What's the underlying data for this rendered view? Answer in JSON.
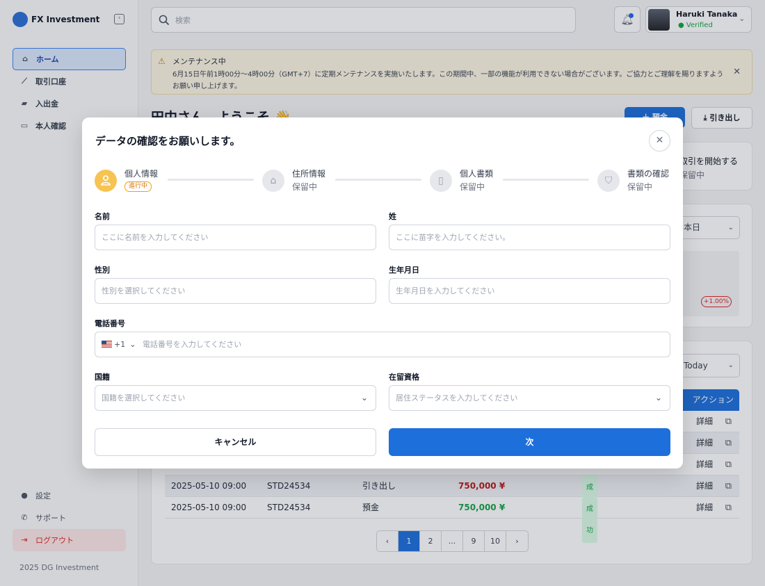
{
  "brand": {
    "name": "FX Investment"
  },
  "sidebar": {
    "items": [
      {
        "label": "ホーム",
        "icon": "home-icon"
      },
      {
        "label": "取引口座",
        "icon": "chart-line-icon"
      },
      {
        "label": "入出金",
        "icon": "wallet-icon"
      },
      {
        "label": "本人確認",
        "icon": "id-card-icon"
      }
    ],
    "bottom": [
      {
        "label": "設定",
        "icon": "user-icon"
      },
      {
        "label": "サポート",
        "icon": "phone-icon"
      },
      {
        "label": "ログアウト",
        "icon": "logout-icon"
      }
    ],
    "copyright": "2025 DG Investment"
  },
  "header": {
    "search_placeholder": "検索",
    "user": {
      "name": "Haruki Tanaka",
      "status": "Verified"
    }
  },
  "notice": {
    "title": "メンテナンス中",
    "body": "6月15日午前1時00分〜4時00分（GMT+7）に定期メンテナンスを実施いたします。この期間中、一部の機能が利用できない場合がございます。ご協力とご理解を賜りますようお願い申し上げます。"
  },
  "dashboard": {
    "welcome": "田中さん、ようこそ 👋",
    "deposit_label": "預金",
    "withdraw_label": "引き出し",
    "card1_title": "取引を開始する",
    "card1_sub": "保留中",
    "period1": "本日",
    "change_badge": "+1.00%",
    "period2": "Today",
    "table": {
      "action_header": "アクション",
      "rows": [
        {
          "date": "",
          "id": "",
          "type": "",
          "amount": "",
          "status": "",
          "detail": "詳細"
        },
        {
          "date": "",
          "id": "",
          "type": "",
          "amount": "",
          "status": "",
          "detail": "詳細"
        },
        {
          "date": "",
          "id": "",
          "type": "",
          "amount": "",
          "status": "",
          "detail": "詳細"
        },
        {
          "date": "2025-05-10 09:00",
          "id": "STD24534",
          "type": "引き出し",
          "amount": "750,000 ¥",
          "status": "成功",
          "detail": "詳細"
        },
        {
          "date": "2025-05-10 09:00",
          "id": "STD24534",
          "type": "預金",
          "amount": "750,000 ¥",
          "status": "成功",
          "detail": "詳細"
        }
      ]
    },
    "pagination": [
      "‹",
      "1",
      "2",
      "...",
      "9",
      "10",
      "›"
    ]
  },
  "modal": {
    "title": "データの確認をお願いします。",
    "steps": [
      {
        "label": "個人情報",
        "status": "進行中",
        "icon": "user-icon"
      },
      {
        "label": "住所情報",
        "status": "保留中",
        "icon": "home-icon"
      },
      {
        "label": "個人書類",
        "status": "保留中",
        "icon": "document-icon"
      },
      {
        "label": "書類の確認",
        "status": "保留中",
        "icon": "shield-icon"
      }
    ],
    "fields": {
      "first_name": {
        "label": "名前",
        "placeholder": "ここに名前を入力してください"
      },
      "last_name": {
        "label": "姓",
        "placeholder": "ここに苗字を入力してください。"
      },
      "gender": {
        "label": "性別",
        "placeholder": "性別を選択してください"
      },
      "birthdate": {
        "label": "生年月日",
        "placeholder": "生年月日を入力してください"
      },
      "phone": {
        "label": "電話番号",
        "dial_code": "+1",
        "placeholder": "電話番号を入力してください"
      },
      "nationality": {
        "label": "国籍",
        "placeholder": "国籍を選択してください"
      },
      "residence": {
        "label": "在留資格",
        "placeholder": "居住ステータスを入力してください"
      }
    },
    "cancel_label": "キャンセル",
    "next_label": "次"
  },
  "colors": {
    "primary": "#1d6fdc",
    "step_active": "#f6c453",
    "danger": "#dc2626",
    "success": "#16a34a"
  }
}
